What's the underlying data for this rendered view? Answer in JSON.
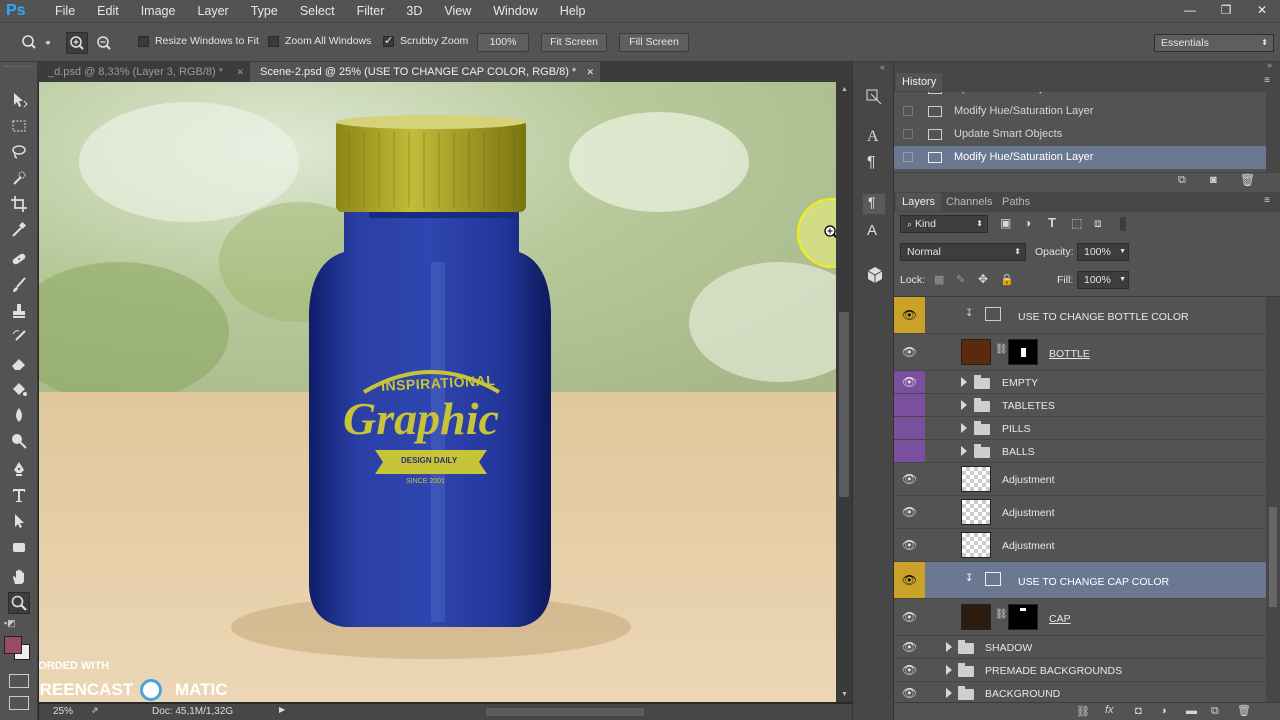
{
  "app": {
    "logo": "Ps"
  },
  "menu": [
    "File",
    "Edit",
    "Image",
    "Layer",
    "Type",
    "Select",
    "Filter",
    "3D",
    "View",
    "Window",
    "Help"
  ],
  "window_controls": {
    "minimize": "—",
    "maximize": "❐",
    "close": "✕"
  },
  "options": {
    "resize_windows": "Resize Windows to Fit",
    "zoom_all": "Zoom All Windows",
    "scrubby_zoom": "Scrubby Zoom",
    "zoom_level": "100%",
    "fit_screen": "Fit Screen",
    "fill_screen": "Fill Screen",
    "workspace": "Essentials"
  },
  "tabs": [
    {
      "label": "_d.psd @ 8,33% (Layer 3, RGB/8) *",
      "close": "✕"
    },
    {
      "label": "Scene-2.psd @ 25% (USE TO CHANGE CAP COLOR, RGB/8) *",
      "close": "✕"
    }
  ],
  "artwork": {
    "top_arc": "INSPIRATIONAL",
    "main": "Graphic",
    "ribbon": "DESIGN DAILY",
    "since": "SINCE 2001"
  },
  "status": {
    "zoom": "25%",
    "doc": "Doc: 45,1M/1,32G"
  },
  "watermark": {
    "line1": "RECORDED WITH",
    "brand_left": "SCREENCAST",
    "brand_right": "MATIC"
  },
  "history": {
    "title": "History",
    "items": [
      {
        "label": "Update Smart Objects"
      },
      {
        "label": "Modify Hue/Saturation Layer"
      },
      {
        "label": "Update Smart Objects"
      },
      {
        "label": "Modify Hue/Saturation Layer"
      }
    ]
  },
  "layers_panel": {
    "tabs": [
      "Layers",
      "Channels",
      "Paths"
    ],
    "filter_kind": "Kind",
    "blend_mode": "Normal",
    "opacity_label": "Opacity:",
    "opacity_value": "100%",
    "lock_label": "Lock:",
    "fill_label": "Fill:",
    "fill_value": "100%",
    "layers": [
      {
        "name": "USE TO CHANGE BOTTLE COLOR"
      },
      {
        "name": "BOTTLE"
      },
      {
        "name": "EMPTY"
      },
      {
        "name": "TABLETES"
      },
      {
        "name": "PILLS"
      },
      {
        "name": "BALLS"
      },
      {
        "name": "Adjustment"
      },
      {
        "name": "Adjustment"
      },
      {
        "name": "Adjustment"
      },
      {
        "name": "USE TO CHANGE CAP COLOR"
      },
      {
        "name": "CAP"
      },
      {
        "name": "SHADOW"
      },
      {
        "name": "PREMADE BACKGROUNDS"
      },
      {
        "name": "BACKGROUND"
      }
    ]
  },
  "colors": {
    "foreground": "#9c4a63",
    "selected_row": "#6a7891",
    "eye_yellow": "#c9a227",
    "eye_purple": "#7a4f9e"
  }
}
